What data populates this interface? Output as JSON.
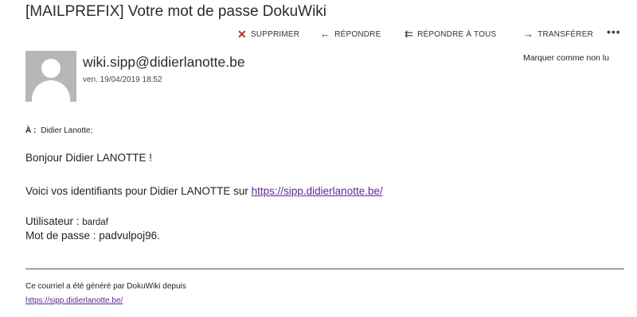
{
  "email": {
    "subject": "[MAILPREFIX] Votre mot de passe DokuWiki",
    "sender": "wiki.sipp@didierlanotte.be",
    "date": "ven. 19/04/2019 18:52",
    "to_label": "À :",
    "to_value": "Didier Lanotte;",
    "mark_unread": "Marquer comme non lu"
  },
  "toolbar": {
    "delete_label": "SUPPRIMER",
    "reply_label": "RÉPONDRE",
    "reply_all_label": "RÉPONDRE À TOUS",
    "forward_label": "TRANSFÉRER",
    "more_label": "•••"
  },
  "body": {
    "greeting": "Bonjour Didier LANOTTE !",
    "intro_text": "Voici vos identifiants pour Didier LANOTTE sur ",
    "link": "https://sipp.didierlanotte.be/",
    "user_label": "Utilisateur : ",
    "user_value": "bardaf",
    "password_line": "Mot de passe : padvulpoj96."
  },
  "footer": {
    "generated_text": "Ce courriel a été généré par DokuWiki depuis",
    "link": "https://sipp.didierlanotte.be/"
  },
  "colors": {
    "delete_icon": "#c8241b",
    "link": "#5a2d8c",
    "avatar_bg": "#b7b7b7"
  },
  "icons": {
    "delete": "close-x-icon",
    "reply": "arrow-left-icon",
    "reply_all": "double-arrow-left-icon",
    "forward": "arrow-right-icon",
    "more": "ellipsis-icon",
    "avatar": "person-avatar-icon"
  }
}
